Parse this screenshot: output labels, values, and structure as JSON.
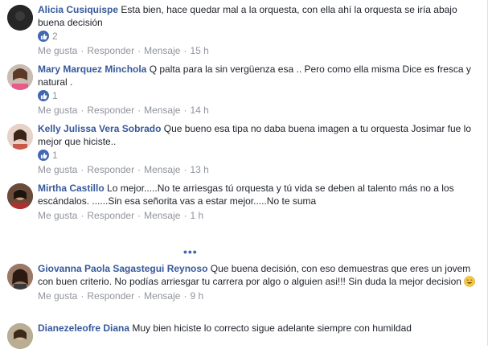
{
  "comments": [
    {
      "author": "Alicia Cusiquispe",
      "text": "Esta bien, hace quedar mal a la orquesta, con ella ahí la orquesta se iría abajo buena decisión",
      "likes": "2",
      "like_label": "Me gusta",
      "reply_label": "Responder",
      "message_label": "Mensaje",
      "time": "15 h"
    },
    {
      "author": "Mary Marquez Minchola",
      "text": "Q palta para la sin vergüenza esa .. Pero como ella misma Dice es fresca y natural .",
      "likes": "1",
      "like_label": "Me gusta",
      "reply_label": "Responder",
      "message_label": "Mensaje",
      "time": "14 h"
    },
    {
      "author": "Kelly Julissa Vera Sobrado",
      "text": "Que bueno esa tipa no daba buena imagen a tu orquesta Josimar fue lo mejor que hiciste..",
      "likes": "1",
      "like_label": "Me gusta",
      "reply_label": "Responder",
      "message_label": "Mensaje",
      "time": "13 h"
    },
    {
      "author": "Mirtha Castillo",
      "text": "Lo mejor.....No te arriesgas tú orquesta y tú vida se deben al talento más no a los escándalos. ......Sin esa señorita vas a estar mejor.....No te suma",
      "like_label": "Me gusta",
      "reply_label": "Responder",
      "message_label": "Mensaje",
      "time": "1 h"
    },
    {
      "author": "Giovanna Paola Sagastegui Reynoso",
      "text": "Que buena decisión, con eso demuestras que eres un jovem con buen criterio. No podías arriesgar tu carrera por algo o alguien asi!!! Sin duda la mejor decision",
      "like_label": "Me gusta",
      "reply_label": "Responder",
      "message_label": "Mensaje",
      "time": "9 h"
    },
    {
      "author": "Dianezeleofre Diana",
      "text": "Muy bien hiciste lo correcto sigue adelante siempre con humildad"
    }
  ],
  "more_label": "•••",
  "separator": "·",
  "colors": {
    "link": "#365899",
    "meta": "#90949c",
    "like_blue": "#4267b2"
  }
}
